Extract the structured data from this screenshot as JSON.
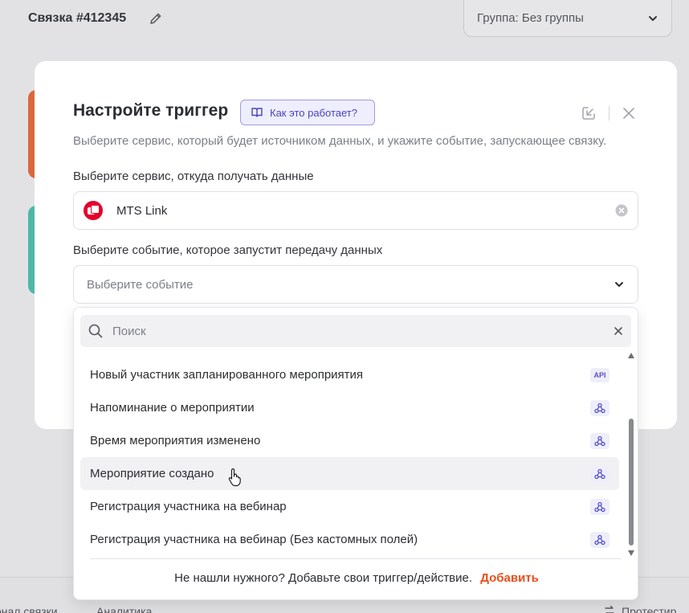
{
  "background": {
    "title": "Связка #412345",
    "group_select": "Группа: Без группы",
    "bottom_tabs": [
      "онал связки",
      "Аналитика"
    ],
    "test_button": "Протестир"
  },
  "modal": {
    "title": "Настройте триггер",
    "how_it_works": "Как это работает?",
    "subtitle": "Выберите сервис, который будет источником данных, и укажите событие, запускающее связку.",
    "service_label": "Выберите сервис, откуда получать данные",
    "service_value": "MTS Link",
    "event_label": "Выберите событие, которое запустит передачу данных",
    "event_placeholder": "Выберите событие"
  },
  "dropdown": {
    "search_placeholder": "Поиск",
    "items": [
      {
        "label": "Новый участник запланированного мероприятия",
        "badge": "API"
      },
      {
        "label": "Напоминание о мероприятии",
        "badge": "webhook"
      },
      {
        "label": "Время мероприятия изменено",
        "badge": "webhook"
      },
      {
        "label": "Мероприятие создано",
        "badge": "webhook"
      },
      {
        "label": "Регистрация участника на вебинар",
        "badge": "webhook"
      },
      {
        "label": "Регистрация участника на вебинар (Без кастомных полей)",
        "badge": "webhook"
      }
    ],
    "footer_text": "Не нашли нужного? Добавьте свои триггер/действие.",
    "footer_link": "Добавить"
  },
  "colors": {
    "accent": "#5650c8",
    "link": "#ea4d1c",
    "mts_red": "#e4002b"
  },
  "icons": [
    "edit-icon",
    "chevron-down-icon",
    "book-icon",
    "collapse-icon",
    "close-icon",
    "clear-icon",
    "search-icon",
    "webhook-icon",
    "hand-cursor-icon"
  ]
}
